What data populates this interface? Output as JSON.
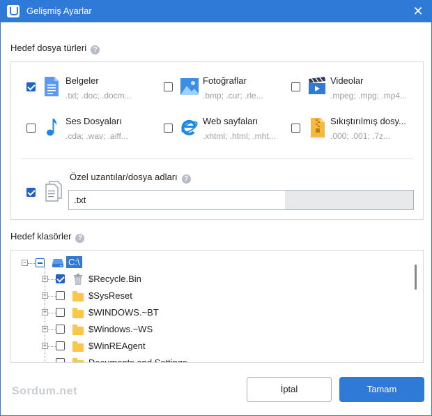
{
  "window": {
    "title": "Gelişmiş Ayarlar",
    "close_glyph": "✕"
  },
  "target_types": {
    "label": "Hedef dosya türleri",
    "help_glyph": "?",
    "items": [
      {
        "name": "Belgeler",
        "ext": ".txt; .doc; .docm...",
        "checked": true,
        "icon": "document-icon"
      },
      {
        "name": "Fotoğraflar",
        "ext": ".bmp; .cur; .rle...",
        "checked": false,
        "icon": "image-icon"
      },
      {
        "name": "Videolar",
        "ext": ".mpeg; .mpg; .mp4...",
        "checked": false,
        "icon": "video-icon"
      },
      {
        "name": "Ses Dosyaları",
        "ext": ".cda; .wav; .aiff...",
        "checked": false,
        "icon": "music-note-icon"
      },
      {
        "name": "Web sayfaları",
        "ext": ".xhtml; .html; .mht...",
        "checked": false,
        "icon": "internet-explorer-icon"
      },
      {
        "name": "Sıkıştırılmış dosy...",
        "ext": ".000; .001; .7z...",
        "checked": false,
        "icon": "archive-icon"
      }
    ],
    "custom": {
      "label": "Özel uzantılar/dosya adları",
      "checked": true,
      "value": ".txt",
      "icon": "files-icon"
    }
  },
  "target_folders": {
    "label": "Hedef klasörler",
    "help_glyph": "?",
    "root": {
      "label": "C:\\",
      "state": "partial",
      "icon": "drive-icon",
      "expander": "−"
    },
    "children": [
      {
        "label": "$Recycle.Bin",
        "checked": true,
        "icon": "recycle-bin-icon",
        "expander": "+"
      },
      {
        "label": "$SysReset",
        "checked": false,
        "icon": "folder-icon",
        "expander": "+"
      },
      {
        "label": "$WINDOWS.~BT",
        "checked": false,
        "icon": "folder-icon",
        "expander": "+"
      },
      {
        "label": "$Windows.~WS",
        "checked": false,
        "icon": "folder-icon",
        "expander": "+"
      },
      {
        "label": "$WinREAgent",
        "checked": false,
        "icon": "folder-icon",
        "expander": "+"
      },
      {
        "label": "Documents and Settings",
        "checked": false,
        "icon": "folder-icon",
        "expander": ""
      }
    ]
  },
  "footer": {
    "brand": "Sordum.net",
    "cancel": "İptal",
    "ok": "Tamam"
  },
  "colors": {
    "accent": "#2f7ad6",
    "checked": "#1f63c6",
    "folder": "#f9c84b"
  }
}
